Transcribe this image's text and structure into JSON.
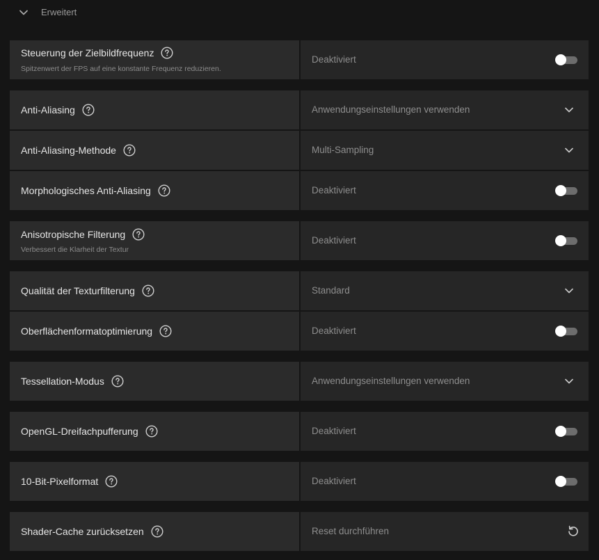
{
  "section": {
    "title": "Erweitert"
  },
  "settings": {
    "frame_rate_target": {
      "title": "Steuerung der Zielbildfrequenz",
      "subtitle": "Spitzenwert der FPS auf eine konstante Frequenz reduzieren.",
      "value": "Deaktiviert",
      "control": "toggle",
      "enabled": false
    },
    "anti_aliasing": {
      "title": "Anti-Aliasing",
      "value": "Anwendungseinstellungen verwenden",
      "control": "dropdown"
    },
    "anti_aliasing_method": {
      "title": "Anti-Aliasing-Methode",
      "value": "Multi-Sampling",
      "control": "dropdown"
    },
    "morphological_aa": {
      "title": "Morphologisches Anti-Aliasing",
      "value": "Deaktiviert",
      "control": "toggle",
      "enabled": false
    },
    "anisotropic_filtering": {
      "title": "Anisotropische Filterung",
      "subtitle": "Verbessert die Klarheit der Textur",
      "value": "Deaktiviert",
      "control": "toggle",
      "enabled": false
    },
    "texture_filtering_quality": {
      "title": "Qualität der Texturfilterung",
      "value": "Standard",
      "control": "dropdown"
    },
    "surface_format_optimization": {
      "title": "Oberflächenformatoptimierung",
      "value": "Deaktiviert",
      "control": "toggle",
      "enabled": false
    },
    "tessellation_mode": {
      "title": "Tessellation-Modus",
      "value": "Anwendungseinstellungen verwenden",
      "control": "dropdown"
    },
    "opengl_triple_buffering": {
      "title": "OpenGL-Dreifachpufferung",
      "value": "Deaktiviert",
      "control": "toggle",
      "enabled": false
    },
    "ten_bit_pixel_format": {
      "title": "10-Bit-Pixelformat",
      "value": "Deaktiviert",
      "control": "toggle",
      "enabled": false
    },
    "shader_cache_reset": {
      "title": "Shader-Cache zurücksetzen",
      "value": "Reset durchführen",
      "control": "action"
    }
  },
  "icons": {
    "section_toggle": "chevron-down-icon",
    "help": "help-icon",
    "dropdown": "chevron-down-icon",
    "reset": "reset-icon"
  },
  "colors": {
    "background": "#151515",
    "row_left": "#2b2b2b",
    "row_right": "#262626",
    "text_primary": "#e6e6e6",
    "text_secondary": "#8e8e8e",
    "toggle_track": "#6d6d6d",
    "toggle_knob": "#ffffff"
  }
}
